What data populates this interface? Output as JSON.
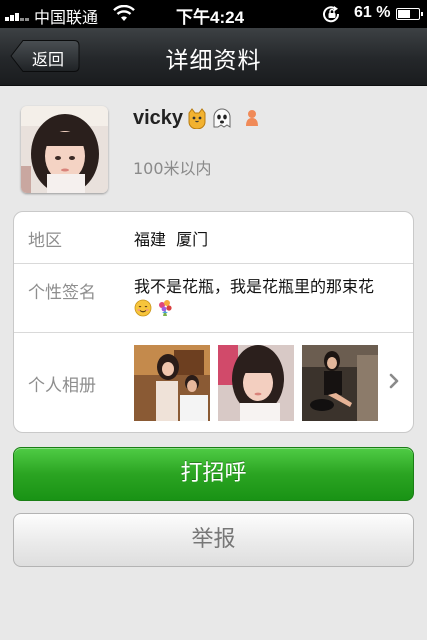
{
  "status_bar": {
    "carrier": "中国联通",
    "time": "下午4:24",
    "battery": "61 %",
    "battery_level": 0.61
  },
  "nav": {
    "back_label": "返回",
    "title": "详细资料"
  },
  "profile": {
    "name": "vicky",
    "name_icons": [
      "cat-face-icon",
      "ghost-icon"
    ],
    "gender_icon": "female-icon",
    "distance": "100米以内"
  },
  "info": {
    "region_label": "地区",
    "region_value": "福建  厦门",
    "signature_label": "个性签名",
    "signature_value": "我不是花瓶，我是花瓶里的那束花",
    "signature_icons": [
      "smiling-face-icon",
      "bouquet-icon"
    ],
    "album_label": "个人相册",
    "album_photo_count_visible": 3
  },
  "actions": {
    "greet_label": "打招呼",
    "report_label": "举报"
  },
  "colors": {
    "nav_bar": "#24272a",
    "primary_green": "#2ba422",
    "background": "#e8e8e8"
  }
}
